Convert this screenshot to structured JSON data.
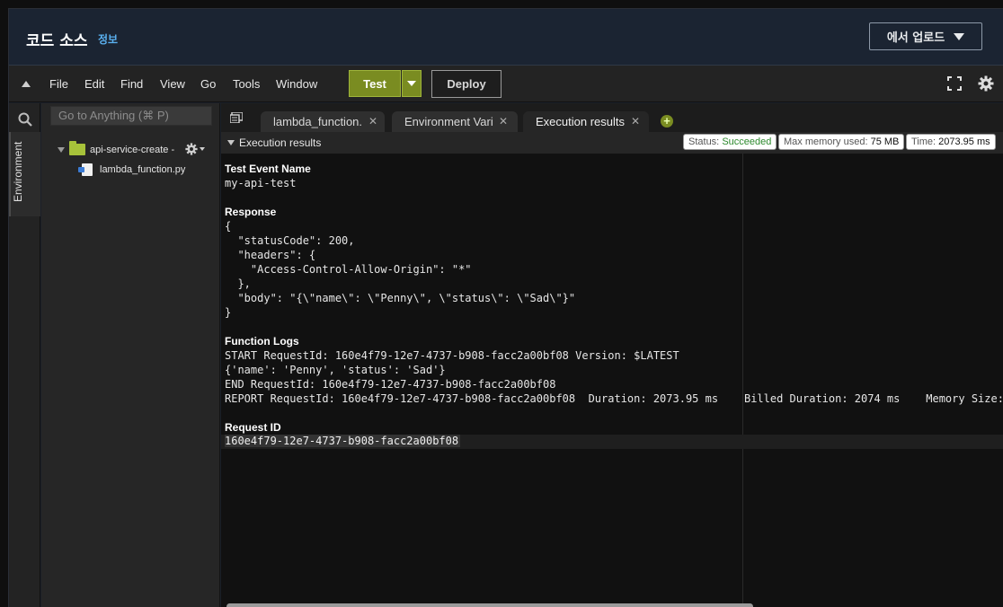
{
  "header": {
    "title": "코드 소스",
    "info_link": "정보",
    "upload_label": "에서 업로드"
  },
  "menubar": {
    "items": [
      "File",
      "Edit",
      "Find",
      "View",
      "Go",
      "Tools",
      "Window"
    ],
    "test_label": "Test",
    "deploy_label": "Deploy"
  },
  "sidebar": {
    "tab_label": "Environment",
    "goto_placeholder": "Go to Anything (⌘ P)",
    "root_folder": "api-service-create -",
    "file": "lambda_function.py"
  },
  "tabs": [
    {
      "label": "lambda_function."
    },
    {
      "label": "Environment Vari"
    },
    {
      "label": "Execution results"
    }
  ],
  "results": {
    "title": "Execution results",
    "status_label": "Status:",
    "status_value": "Succeeded",
    "memory_label": "Max memory used:",
    "memory_value": "75 MB",
    "time_label": "Time:",
    "time_value": "2073.95 ms",
    "test_event_label": "Test Event Name",
    "test_event_value": "my-api-test",
    "response_label": "Response",
    "response_lines": [
      "{",
      "  \"statusCode\": 200,",
      "  \"headers\": {",
      "    \"Access-Control-Allow-Origin\": \"*\"",
      "  },",
      "  \"body\": \"{\\\"name\\\": \\\"Penny\\\", \\\"status\\\": \\\"Sad\\\"}\"",
      "}"
    ],
    "logs_label": "Function Logs",
    "log_lines": [
      "START RequestId: 160e4f79-12e7-4737-b908-facc2a00bf08 Version: $LATEST",
      "{'name': 'Penny', 'status': 'Sad'}",
      "END RequestId: 160e4f79-12e7-4737-b908-facc2a00bf08",
      "REPORT RequestId: 160e4f79-12e7-4737-b908-facc2a00bf08  Duration: 2073.95 ms    Billed Duration: 2074 ms    Memory Size:"
    ],
    "request_id_label": "Request ID",
    "request_id_value": "160e4f79-12e7-4737-b908-facc2a00bf08"
  },
  "icons": {
    "collapse": "collapse-up-icon",
    "fullscreen": "fullscreen-icon",
    "settings": "gear-icon",
    "search": "search-icon",
    "folder": "folder-icon",
    "file": "python-file-icon",
    "add_tab": "plus-icon"
  },
  "colors": {
    "accent": "#7a8c21",
    "link": "#5ab0ef",
    "success": "#2d8a2d"
  }
}
